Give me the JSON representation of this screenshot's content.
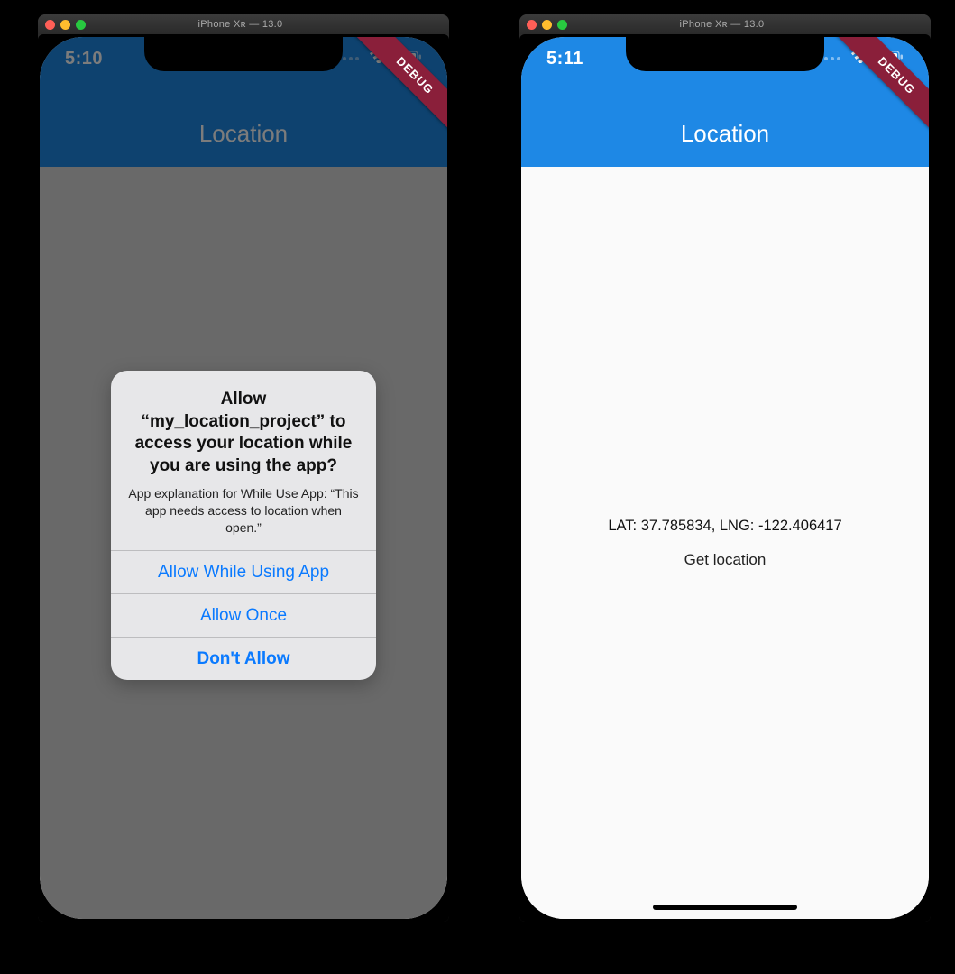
{
  "simulator": {
    "title": "iPhone Xʀ — 13.0"
  },
  "left": {
    "status": {
      "time": "5:10"
    },
    "header": {
      "title": "Location"
    },
    "ribbon": "DEBUG",
    "alert": {
      "title": "Allow “my_location_project” to access your location while you are using the app?",
      "message": "App explanation for While Use App: “This app needs access to location when open.”",
      "buttons": {
        "allow_while": "Allow While Using App",
        "allow_once": "Allow Once",
        "dont_allow": "Don't Allow"
      }
    }
  },
  "right": {
    "status": {
      "time": "5:11"
    },
    "header": {
      "title": "Location"
    },
    "ribbon": "DEBUG",
    "body": {
      "lat_lng": "LAT: 37.785834, LNG: -122.406417",
      "get_location_label": "Get location"
    }
  },
  "icons": {
    "wifi": "wifi-icon",
    "battery": "battery-icon"
  },
  "colors": {
    "header_blue": "#1E88E5",
    "ios_blue": "#0a7aff",
    "ribbon": "#8a1f3a"
  }
}
